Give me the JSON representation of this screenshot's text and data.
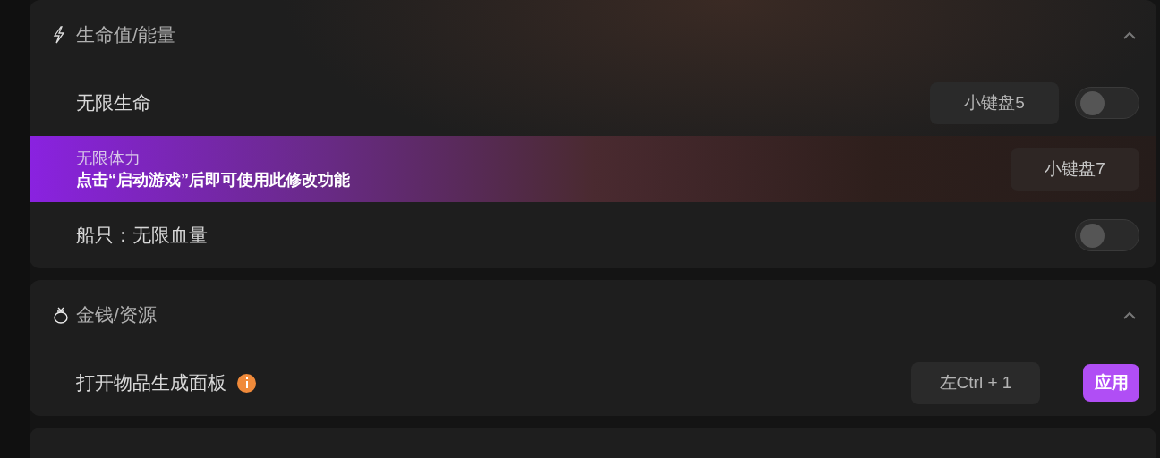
{
  "sections": [
    {
      "title": "生命值/能量",
      "expanded": true,
      "rows": [
        {
          "kind": "toggle",
          "label": "无限生命",
          "hotkey": "小键盘5",
          "on": false
        },
        {
          "kind": "notice",
          "label": "无限体力",
          "hint": "点击“启动游戏”后即可使用此修改功能",
          "hotkey": "小键盘7"
        },
        {
          "kind": "toggle",
          "label": "船只：无限血量",
          "on": false
        }
      ]
    },
    {
      "title": "金钱/资源",
      "expanded": true,
      "rows": [
        {
          "kind": "apply",
          "label": "打开物品生成面板",
          "info": true,
          "hotkey": "左Ctrl + 1",
          "button": "应用"
        }
      ]
    }
  ]
}
